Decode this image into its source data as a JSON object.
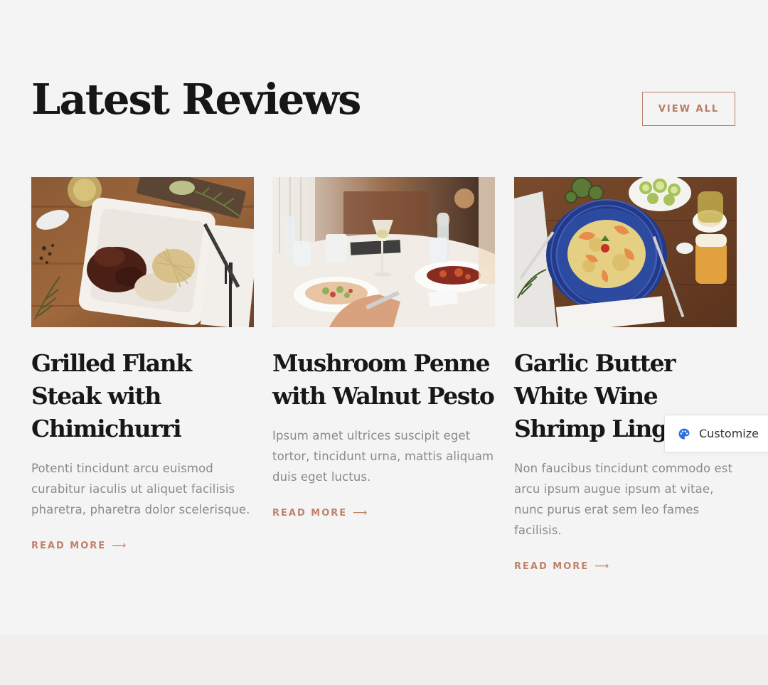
{
  "section": {
    "title": "Latest Reviews",
    "view_all_label": "VIEW ALL"
  },
  "reviews": [
    {
      "image": "grilled-steak-plate",
      "title": "Grilled Flank Steak with Chimichurri",
      "excerpt": "Potenti tincidunt arcu euismod curabitur iaculis ut aliquet facilisis pharetra, pharetra dolor scelerisque.",
      "read_more": "READ MORE"
    },
    {
      "image": "restaurant-table",
      "title": "Mushroom Penne with Walnut Pesto",
      "excerpt": "Ipsum amet ultrices suscipit eget tortor, tincidunt urna, mattis aliquam duis eget luctus.",
      "read_more": "READ MORE"
    },
    {
      "image": "shrimp-linguine",
      "title": "Garlic Butter White Wine Shrimp Linguine",
      "excerpt": "Non faucibus tincidunt commodo est arcu ipsum augue ipsum at vitae, nunc purus erat sem leo fames facilisis.",
      "read_more": "READ MORE"
    }
  ],
  "customize": {
    "label": "Customize",
    "icon": "palette-icon"
  },
  "colors": {
    "background": "#f4f4f4",
    "accent": "#c0826a",
    "heading": "#161616",
    "body_text": "#8a8a8a",
    "customize_icon": "#2f6fdf"
  }
}
